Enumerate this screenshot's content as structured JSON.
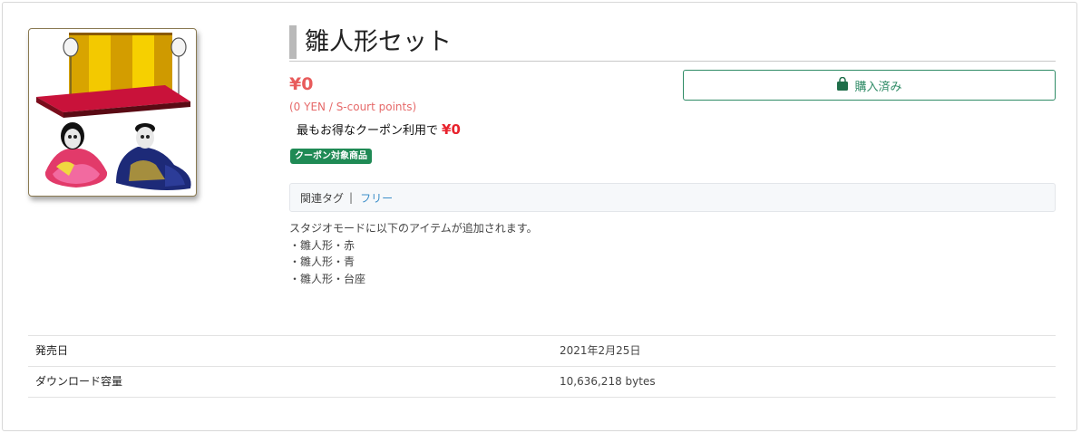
{
  "product": {
    "title": "雛人形セット",
    "thumbnail_alt": "hina-doll-set-thumbnail",
    "price": "¥0",
    "price_note": "(0 YEN / S-court points)",
    "coupon_text": "最もお得なクーポン利用で",
    "coupon_price": "¥0",
    "coupon_badge": "クーポン対象商品",
    "purchase_button": {
      "label": "購入済み",
      "icon": "shopping-bag-icon"
    },
    "tags": {
      "label": "関連タグ",
      "separator": "|",
      "items": [
        "フリー"
      ]
    },
    "description": [
      "スタジオモードに以下のアイテムが追加されます。",
      "・雛人形・赤",
      "・雛人形・青",
      "・雛人形・台座"
    ]
  },
  "details": [
    {
      "key": "発売日",
      "value": "2021年2月25日"
    },
    {
      "key": "ダウンロード容量",
      "value": "10,636,218 bytes"
    }
  ],
  "colors": {
    "price": "#e85b5b",
    "badge": "#1f8a55",
    "button_accent": "#2f8b66",
    "tag_link": "#3d8fc9"
  }
}
